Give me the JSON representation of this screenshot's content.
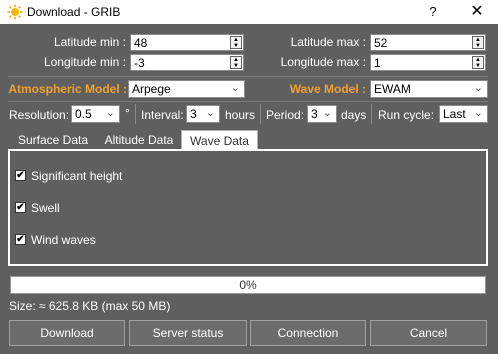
{
  "window": {
    "title": "Download - GRIB",
    "help": "?",
    "close": "✕"
  },
  "coords": {
    "lat_min_label": "Latitude min :",
    "lat_min": "48",
    "lat_max_label": "Latitude max :",
    "lat_max": "52",
    "lon_min_label": "Longitude min :",
    "lon_min": "-3",
    "lon_max_label": "Longitude max :",
    "lon_max": "1"
  },
  "models": {
    "atmo_label": "Atmospheric Model :",
    "atmo": "Arpege",
    "wave_label": "Wave Model :",
    "wave": "EWAM"
  },
  "params": {
    "resolution_label": "Resolution:",
    "resolution": "0.5",
    "deg": "°",
    "interval_label": "Interval:",
    "interval": "3",
    "hours": "hours",
    "period_label": "Period:",
    "period": "3",
    "days": "days",
    "runcycle_label": "Run cycle:",
    "runcycle": "Last"
  },
  "tabs": [
    "Surface Data",
    "Altitude Data",
    "Wave Data"
  ],
  "wave_options": [
    {
      "label": "Significant height",
      "checked": true
    },
    {
      "label": "Swell",
      "checked": true
    },
    {
      "label": "Wind waves",
      "checked": true
    }
  ],
  "progress": {
    "text": "0%",
    "value": 0
  },
  "size_text": "Size: ≈ 625.8 KB (max 50 MB)",
  "buttons": {
    "download": "Download",
    "server_status": "Server status",
    "connection": "Connection",
    "cancel": "Cancel"
  },
  "colors": {
    "background": "#5f5f5f",
    "accent": "#f0a030"
  },
  "icons": {
    "app": "sun-icon",
    "spin": "spin-arrows-icon",
    "dropdown": "chevron-down-icon",
    "check": "check-icon"
  }
}
